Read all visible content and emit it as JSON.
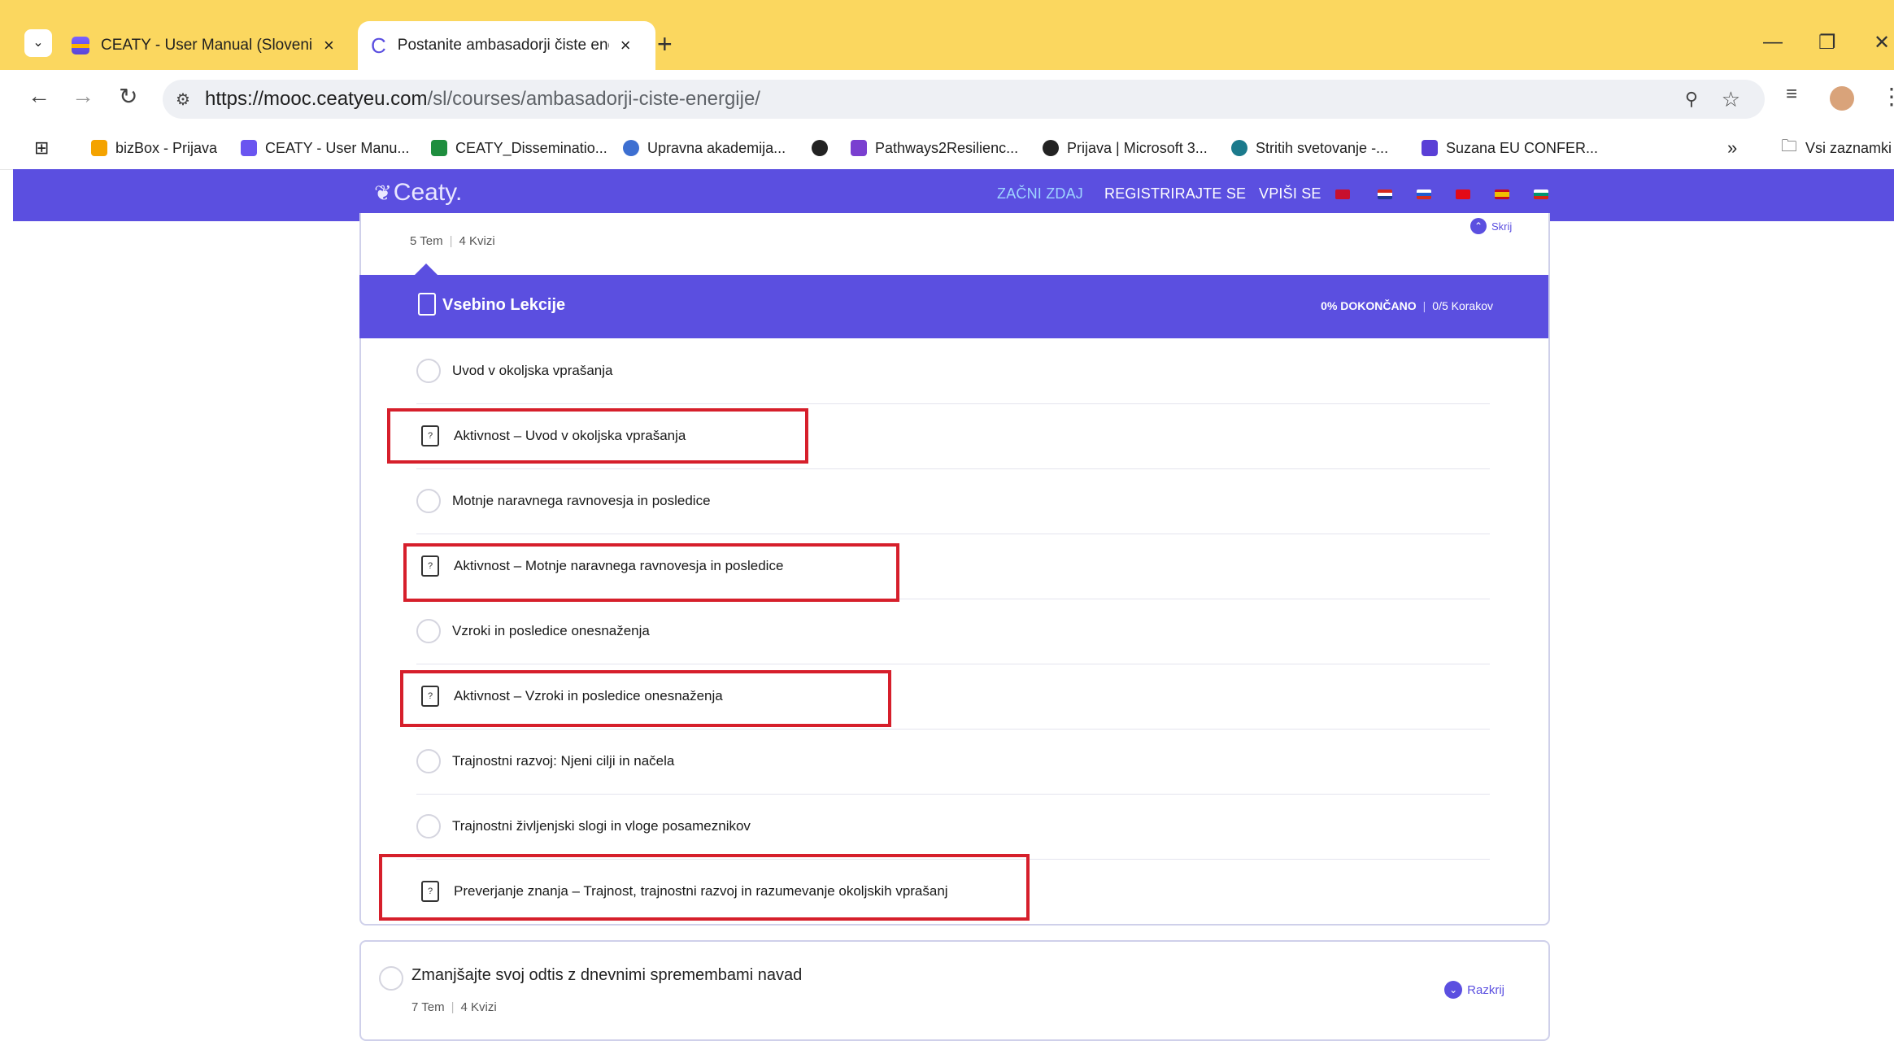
{
  "browser": {
    "tabs": [
      {
        "title": "CEATY - User Manual (Slovenia)",
        "close": "×"
      },
      {
        "title": "Postanite ambasadorji čiste ene",
        "close": "×"
      }
    ],
    "new_tab": "+",
    "window_controls": {
      "minimize": "—",
      "restore": "❐",
      "close": "✕"
    },
    "url_host": "https://mooc.ceatyeu.com",
    "url_path": "/sl/courses/ambasadorji-ciste-energije/",
    "bookmarks": [
      {
        "label": "bizBox - Prijava",
        "color": "#f4a300"
      },
      {
        "label": "CEATY - User Manu...",
        "color": "#6a55f0"
      },
      {
        "label": "CEATY_Disseminatio...",
        "color": "#1e8e3e"
      },
      {
        "label": "Upravna akademija...",
        "color": "#3d6fd1"
      },
      {
        "label": "",
        "color": "#222222"
      },
      {
        "label": "Pathways2Resilienc...",
        "color": "#7a3fd0"
      },
      {
        "label": "Prijava | Microsoft 3...",
        "color": "#222222"
      },
      {
        "label": "Stritih svetovanje -...",
        "color": "#1b7a8c"
      },
      {
        "label": "Suzana EU CONFER...",
        "color": "#5a3fd6"
      }
    ],
    "bookmarks_overflow": "»",
    "bookmarks_folder": "Vsi zaznamki"
  },
  "site": {
    "logo": "Ceaty.",
    "nav": [
      "ZAČNI ZDAJ",
      "REGISTRIRAJTE SE",
      "VPIŠI SE"
    ],
    "flag_colors": [
      "#c8102e",
      "#d52b1e",
      "#1f5ad1",
      "#e30a17",
      "#f1bf00",
      "#00966e"
    ]
  },
  "course1": {
    "meta_topics": "5 Tem",
    "meta_quizzes": "4 Kvizi",
    "toggle_label": "Skrij",
    "section_title": "Vsebino Lekcije",
    "progress_pct": "0% DOKONČANO",
    "progress_steps": "0/5 Korakov",
    "items": [
      {
        "label": "Uvod v okoljska vprašanja",
        "kind": "lesson"
      },
      {
        "label": "Aktivnost – Uvod v okoljska vprašanja",
        "kind": "quiz"
      },
      {
        "label": "Motnje naravnega ravnovesja in posledice",
        "kind": "lesson"
      },
      {
        "label": "Aktivnost – Motnje naravnega ravnovesja in posledice",
        "kind": "quiz"
      },
      {
        "label": "Vzroki in posledice onesnaženja",
        "kind": "lesson"
      },
      {
        "label": "Aktivnost – Vzroki in posledice onesnaženja",
        "kind": "quiz"
      },
      {
        "label": "Trajnostni razvoj: Njeni cilji in načela",
        "kind": "lesson"
      },
      {
        "label": "Trajnostni življenjski slogi in vloge posameznikov",
        "kind": "lesson"
      },
      {
        "label": "Preverjanje znanja – Trajnost, trajnostni razvoj in razumevanje okoljskih vprašanj",
        "kind": "quiz"
      }
    ]
  },
  "course2": {
    "title": "Zmanjšajte svoj odtis z dnevnimi spremembami navad",
    "meta_topics": "7 Tem",
    "meta_quizzes": "4 Kvizi",
    "toggle_label": "Razkrij"
  },
  "colors": {
    "brand": "#5b4fe0",
    "tabstrip": "#fbd75f",
    "highlight": "#d61f2b"
  }
}
